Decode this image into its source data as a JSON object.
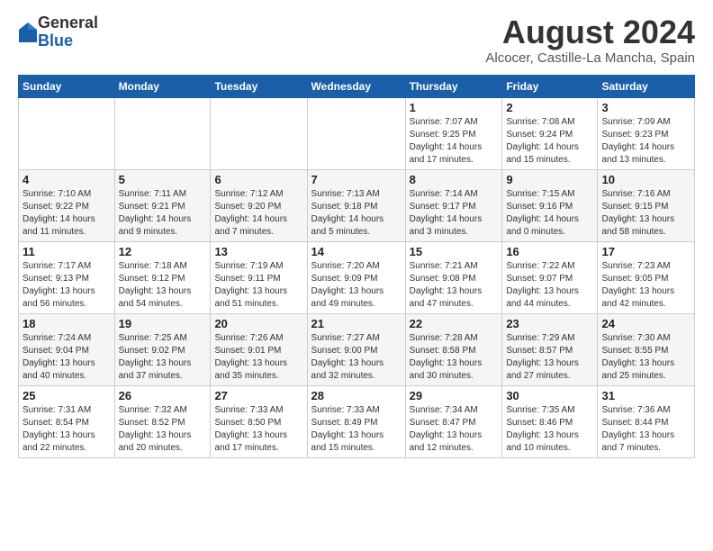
{
  "header": {
    "logo_general": "General",
    "logo_blue": "Blue",
    "month_title": "August 2024",
    "location": "Alcocer, Castille-La Mancha, Spain"
  },
  "weekdays": [
    "Sunday",
    "Monday",
    "Tuesday",
    "Wednesday",
    "Thursday",
    "Friday",
    "Saturday"
  ],
  "weeks": [
    [
      {
        "day": "",
        "info": ""
      },
      {
        "day": "",
        "info": ""
      },
      {
        "day": "",
        "info": ""
      },
      {
        "day": "",
        "info": ""
      },
      {
        "day": "1",
        "info": "Sunrise: 7:07 AM\nSunset: 9:25 PM\nDaylight: 14 hours\nand 17 minutes."
      },
      {
        "day": "2",
        "info": "Sunrise: 7:08 AM\nSunset: 9:24 PM\nDaylight: 14 hours\nand 15 minutes."
      },
      {
        "day": "3",
        "info": "Sunrise: 7:09 AM\nSunset: 9:23 PM\nDaylight: 14 hours\nand 13 minutes."
      }
    ],
    [
      {
        "day": "4",
        "info": "Sunrise: 7:10 AM\nSunset: 9:22 PM\nDaylight: 14 hours\nand 11 minutes."
      },
      {
        "day": "5",
        "info": "Sunrise: 7:11 AM\nSunset: 9:21 PM\nDaylight: 14 hours\nand 9 minutes."
      },
      {
        "day": "6",
        "info": "Sunrise: 7:12 AM\nSunset: 9:20 PM\nDaylight: 14 hours\nand 7 minutes."
      },
      {
        "day": "7",
        "info": "Sunrise: 7:13 AM\nSunset: 9:18 PM\nDaylight: 14 hours\nand 5 minutes."
      },
      {
        "day": "8",
        "info": "Sunrise: 7:14 AM\nSunset: 9:17 PM\nDaylight: 14 hours\nand 3 minutes."
      },
      {
        "day": "9",
        "info": "Sunrise: 7:15 AM\nSunset: 9:16 PM\nDaylight: 14 hours\nand 0 minutes."
      },
      {
        "day": "10",
        "info": "Sunrise: 7:16 AM\nSunset: 9:15 PM\nDaylight: 13 hours\nand 58 minutes."
      }
    ],
    [
      {
        "day": "11",
        "info": "Sunrise: 7:17 AM\nSunset: 9:13 PM\nDaylight: 13 hours\nand 56 minutes."
      },
      {
        "day": "12",
        "info": "Sunrise: 7:18 AM\nSunset: 9:12 PM\nDaylight: 13 hours\nand 54 minutes."
      },
      {
        "day": "13",
        "info": "Sunrise: 7:19 AM\nSunset: 9:11 PM\nDaylight: 13 hours\nand 51 minutes."
      },
      {
        "day": "14",
        "info": "Sunrise: 7:20 AM\nSunset: 9:09 PM\nDaylight: 13 hours\nand 49 minutes."
      },
      {
        "day": "15",
        "info": "Sunrise: 7:21 AM\nSunset: 9:08 PM\nDaylight: 13 hours\nand 47 minutes."
      },
      {
        "day": "16",
        "info": "Sunrise: 7:22 AM\nSunset: 9:07 PM\nDaylight: 13 hours\nand 44 minutes."
      },
      {
        "day": "17",
        "info": "Sunrise: 7:23 AM\nSunset: 9:05 PM\nDaylight: 13 hours\nand 42 minutes."
      }
    ],
    [
      {
        "day": "18",
        "info": "Sunrise: 7:24 AM\nSunset: 9:04 PM\nDaylight: 13 hours\nand 40 minutes."
      },
      {
        "day": "19",
        "info": "Sunrise: 7:25 AM\nSunset: 9:02 PM\nDaylight: 13 hours\nand 37 minutes."
      },
      {
        "day": "20",
        "info": "Sunrise: 7:26 AM\nSunset: 9:01 PM\nDaylight: 13 hours\nand 35 minutes."
      },
      {
        "day": "21",
        "info": "Sunrise: 7:27 AM\nSunset: 9:00 PM\nDaylight: 13 hours\nand 32 minutes."
      },
      {
        "day": "22",
        "info": "Sunrise: 7:28 AM\nSunset: 8:58 PM\nDaylight: 13 hours\nand 30 minutes."
      },
      {
        "day": "23",
        "info": "Sunrise: 7:29 AM\nSunset: 8:57 PM\nDaylight: 13 hours\nand 27 minutes."
      },
      {
        "day": "24",
        "info": "Sunrise: 7:30 AM\nSunset: 8:55 PM\nDaylight: 13 hours\nand 25 minutes."
      }
    ],
    [
      {
        "day": "25",
        "info": "Sunrise: 7:31 AM\nSunset: 8:54 PM\nDaylight: 13 hours\nand 22 minutes."
      },
      {
        "day": "26",
        "info": "Sunrise: 7:32 AM\nSunset: 8:52 PM\nDaylight: 13 hours\nand 20 minutes."
      },
      {
        "day": "27",
        "info": "Sunrise: 7:33 AM\nSunset: 8:50 PM\nDaylight: 13 hours\nand 17 minutes."
      },
      {
        "day": "28",
        "info": "Sunrise: 7:33 AM\nSunset: 8:49 PM\nDaylight: 13 hours\nand 15 minutes."
      },
      {
        "day": "29",
        "info": "Sunrise: 7:34 AM\nSunset: 8:47 PM\nDaylight: 13 hours\nand 12 minutes."
      },
      {
        "day": "30",
        "info": "Sunrise: 7:35 AM\nSunset: 8:46 PM\nDaylight: 13 hours\nand 10 minutes."
      },
      {
        "day": "31",
        "info": "Sunrise: 7:36 AM\nSunset: 8:44 PM\nDaylight: 13 hours\nand 7 minutes."
      }
    ]
  ]
}
